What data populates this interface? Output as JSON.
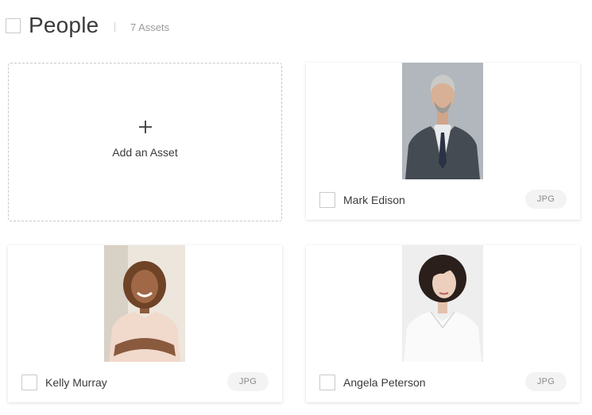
{
  "header": {
    "title": "People",
    "asset_count": "7 Assets"
  },
  "add_card": {
    "label": "Add an Asset",
    "icon": "plus-icon"
  },
  "assets": [
    {
      "name": "Mark Edison",
      "type": "JPG",
      "photo": "man-in-suit-portrait"
    },
    {
      "name": "Kelly Murray",
      "type": "JPG",
      "photo": "smiling-woman-curly-hair-portrait"
    },
    {
      "name": "Angela Peterson",
      "type": "JPG",
      "photo": "woman-white-shirt-portrait"
    }
  ],
  "colors": {
    "background": "#ffffff",
    "text": "#3a3a3a",
    "muted_text": "#9a9a9a",
    "badge_bg": "#f3f3f3",
    "border": "#c9c9c9"
  }
}
